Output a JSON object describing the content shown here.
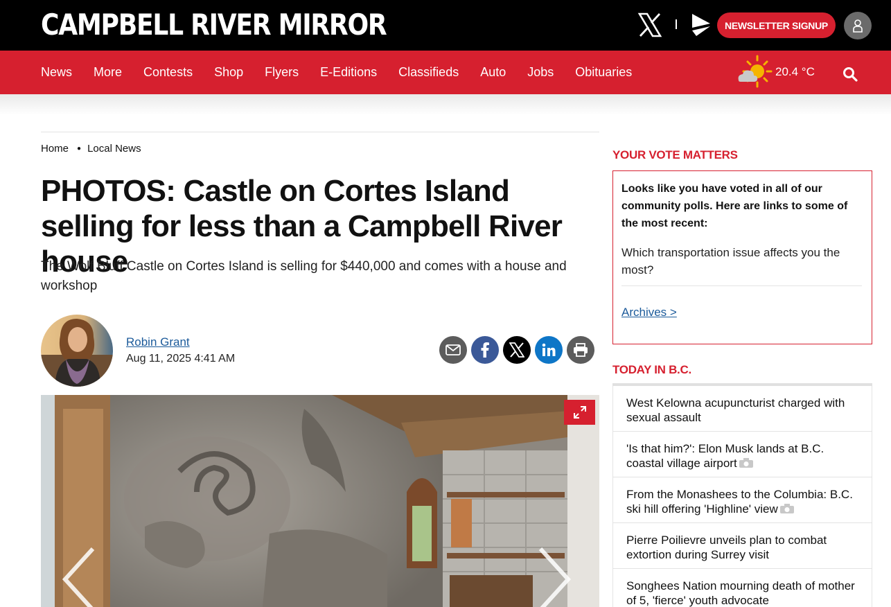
{
  "header": {
    "logo": "CAMPBELL RIVER MIRROR",
    "newsletter_label": "NEWSLETTER SIGNUP"
  },
  "nav": {
    "items": [
      "News",
      "More",
      "Contests",
      "Shop",
      "Flyers",
      "E-Editions",
      "Classifieds",
      "Auto",
      "Jobs",
      "Obituaries"
    ],
    "temperature": "20.4 °C"
  },
  "breadcrumb": {
    "home": "Home",
    "section": "Local News"
  },
  "article": {
    "headline": "PHOTOS: Castle on Cortes Island selling for less than a Campbell River house",
    "subhead": "The Wolf Bluff Castle on Cortes Island is selling for $440,000 and comes with a house and workshop",
    "author": "Robin Grant",
    "date": "Aug 11, 2025 4:41 AM"
  },
  "colors": {
    "brand_red": "#d6202f",
    "link_blue": "#1b5a9a",
    "facebook": "#3b5998",
    "linkedin": "#0e76c7"
  },
  "sidebar": {
    "poll_title": "YOUR VOTE MATTERS",
    "poll_intro": "Looks like you have voted in all of our community polls. Here are links to some of the most recent:",
    "poll_question": "Which transportation issue affects you the most?",
    "archives": "Archives >",
    "today_title": "TODAY IN B.C.",
    "today_items": [
      "West Kelowna acupuncturist charged with sexual assault",
      "'Is that him?': Elon Musk lands at B.C. coastal village airport",
      "From the Monashees to the Columbia: B.C. ski hill offering 'Highline' view",
      "Pierre Poilievre unveils plan to combat extortion during Surrey visit",
      "Songhees Nation mourning death of mother of 5, 'fierce' youth advocate"
    ]
  }
}
